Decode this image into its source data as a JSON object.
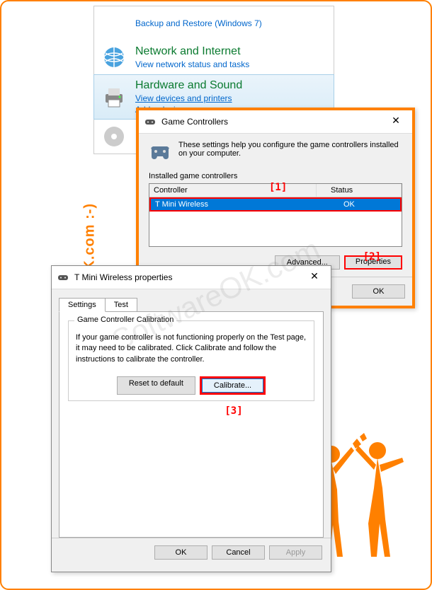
{
  "watermark": {
    "sidebar": "www.SoftwareOK.com  :-)",
    "diagonal": "SoftwareOK.com"
  },
  "controlPanel": {
    "items": [
      {
        "title": "",
        "links": [
          "Backup and Restore (Windows 7)"
        ],
        "icon": ""
      },
      {
        "title": "Network and Internet",
        "links": [
          "View network status and tasks"
        ],
        "icon": "globe"
      },
      {
        "title": "Hardware and Sound",
        "links": [
          "View devices and printers",
          "Add a device"
        ],
        "icon": "printer",
        "selected": true
      }
    ]
  },
  "gameControllers": {
    "title": "Game Controllers",
    "description": "These settings help you configure the game controllers installed on your computer.",
    "tableLabel": "Installed game controllers",
    "headers": {
      "controller": "Controller",
      "status": "Status"
    },
    "row": {
      "name": "T Mini Wireless",
      "status": "OK"
    },
    "buttons": {
      "advanced": "Advanced...",
      "properties": "Properties",
      "ok": "OK"
    },
    "annotations": {
      "one": "[1]",
      "two": "[2]"
    }
  },
  "propsDialog": {
    "title": "T Mini Wireless properties",
    "tabs": {
      "settings": "Settings",
      "test": "Test"
    },
    "groupTitle": "Game Controller Calibration",
    "groupText": "If your game controller is not functioning properly on the Test page, it may need to be calibrated.  Click Calibrate and follow the instructions to calibrate the controller.",
    "buttons": {
      "reset": "Reset to default",
      "calibrate": "Calibrate...",
      "ok": "OK",
      "cancel": "Cancel",
      "apply": "Apply"
    },
    "annotation": "[3]"
  }
}
